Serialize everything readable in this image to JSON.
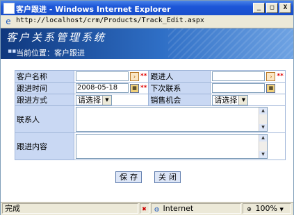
{
  "window": {
    "title": "客户跟进 - Windows Internet Explorer",
    "url": "http://localhost/crm/Products/Track_Edit.aspx",
    "minimize_label": "_",
    "maximize_label": "□",
    "close_label": "X"
  },
  "banner": {
    "brand": "客户关系管理系统",
    "crumb": "当前位置：客户跟进"
  },
  "form": {
    "customer_name_label": "客户名称",
    "customer_name_value": "",
    "follower_label": "跟进人",
    "follower_value": "",
    "follow_time_label": "跟进时间",
    "follow_time_value": "2008-05-18",
    "next_contact_label": "下次联系",
    "next_contact_value": "",
    "method_label": "跟进方式",
    "method_value": "请选择",
    "opportunity_label": "销售机会",
    "opportunity_value": "请选择",
    "contact_label": "联系人",
    "content_label": "跟进内容",
    "required_mark": "**",
    "pick_icon_glyph": "›",
    "calendar_icon_glyph": "▦"
  },
  "buttons": {
    "save": "保存",
    "close": "关闭"
  },
  "statusbar": {
    "status": "完成",
    "zone": "Internet",
    "zoom": "100%"
  },
  "colors": {
    "label_bg": "#c9d8f3",
    "border": "#9fb5d8",
    "required": "#e00000",
    "title_bar": "#1c56d8"
  }
}
